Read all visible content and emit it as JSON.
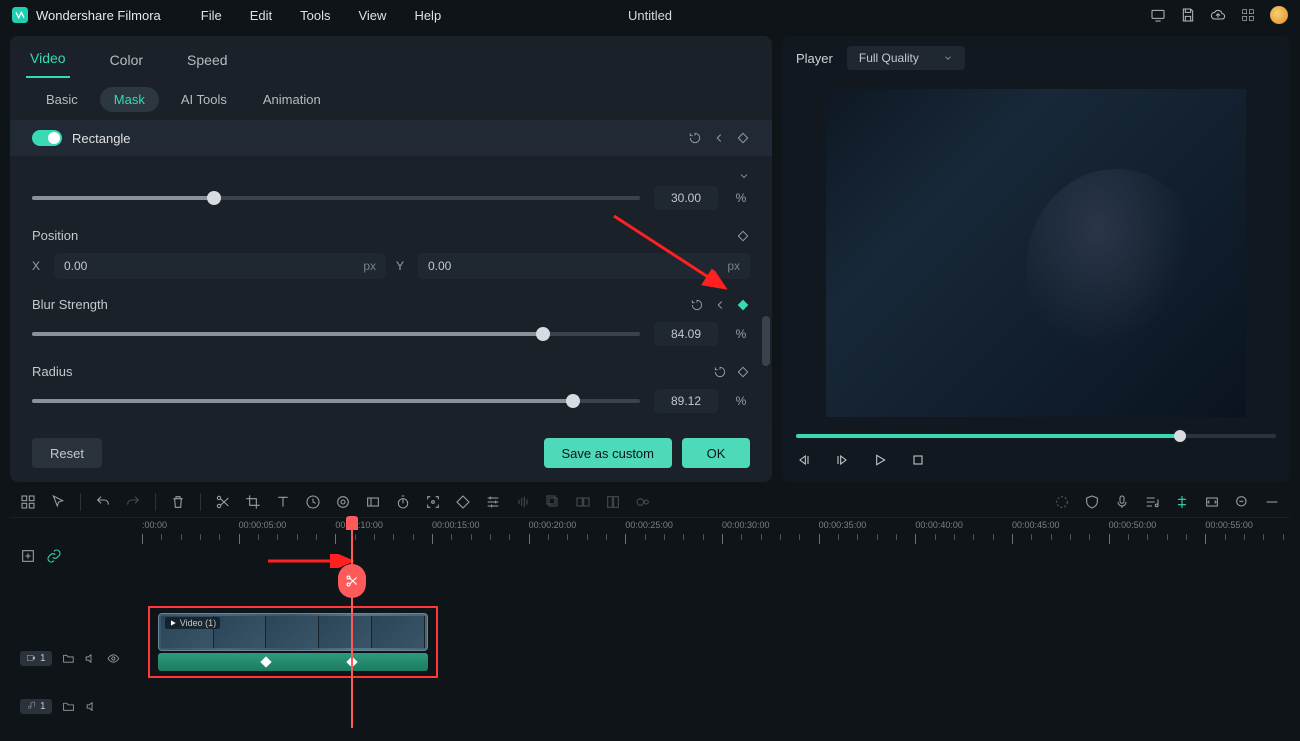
{
  "app": {
    "name": "Wondershare Filmora",
    "document": "Untitled"
  },
  "menu": [
    "File",
    "Edit",
    "Tools",
    "View",
    "Help"
  ],
  "tabs_top": [
    "Video",
    "Color",
    "Speed"
  ],
  "tabs_top_active": "Video",
  "subtabs": [
    "Basic",
    "Mask",
    "AI Tools",
    "Animation"
  ],
  "subtab_active": "Mask",
  "section": {
    "name": "Rectangle"
  },
  "props": {
    "slider1": {
      "value": "30.00",
      "unit": "%",
      "pct": 30
    },
    "position": {
      "label": "Position",
      "x_label": "X",
      "x_value": "0.00",
      "x_unit": "px",
      "y_label": "Y",
      "y_value": "0.00",
      "y_unit": "px"
    },
    "blur": {
      "label": "Blur Strength",
      "value": "84.09",
      "unit": "%",
      "pct": 84
    },
    "radius": {
      "label": "Radius",
      "value": "89.12",
      "unit": "%",
      "pct": 89
    }
  },
  "buttons": {
    "reset": "Reset",
    "save_custom": "Save as custom",
    "ok": "OK"
  },
  "preview": {
    "label": "Player",
    "quality": "Full Quality"
  },
  "timeline": {
    "timecodes": [
      ":00:00",
      "00:00:05:00",
      "00:00:10:00",
      "00:00:15:00",
      "00:00:20:00",
      "00:00:25:00",
      "00:00:30:00",
      "00:00:35:00",
      "00:00:40:00",
      "00:00:45:00",
      "00:00:50:00",
      "00:00:55:00"
    ],
    "playhead_pct": 18,
    "clip": {
      "label": "Video (1)",
      "start_pct": 0.5,
      "width_pct": 25
    },
    "track_video": "1",
    "track_audio": "1"
  }
}
